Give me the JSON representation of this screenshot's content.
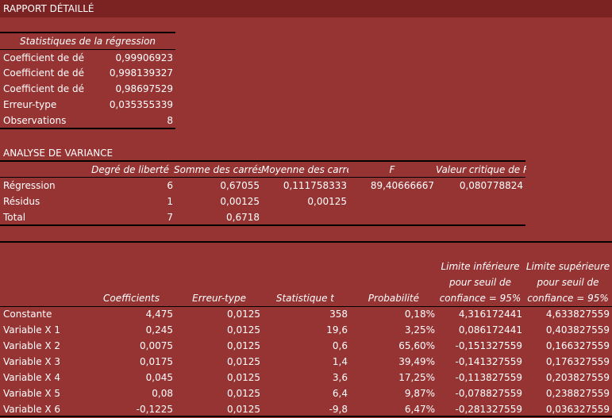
{
  "report_title": "RAPPORT DÉTAILLÉ",
  "regression_stats": {
    "header": "Statistiques de la régression",
    "rows": [
      {
        "label": "Coefficient de dé",
        "value": "0,99906923"
      },
      {
        "label": "Coefficient de dé",
        "value": "0,998139327"
      },
      {
        "label": "Coefficient de dé",
        "value": "0,98697529"
      },
      {
        "label": "Erreur-type",
        "value": "0,035355339"
      },
      {
        "label": "Observations",
        "value": "8"
      }
    ]
  },
  "anova": {
    "title": "ANALYSE DE VARIANCE",
    "headers": [
      "Degré de liberté",
      "Somme des carrés",
      "Moyenne des carré",
      "F",
      "Valeur critique de F"
    ],
    "rows": [
      {
        "label": "Régression",
        "values": [
          "6",
          "0,67055",
          "0,111758333",
          "89,40666667",
          "0,080778824"
        ]
      },
      {
        "label": "Résidus",
        "values": [
          "1",
          "0,00125",
          "0,00125",
          "",
          ""
        ]
      },
      {
        "label": "Total",
        "values": [
          "7",
          "0,6718",
          "",
          "",
          ""
        ]
      }
    ]
  },
  "coefficients": {
    "headers": [
      "Coefficients",
      "Erreur-type",
      "Statistique t",
      "Probabilité",
      [
        "Limite inférieure",
        "pour seuil de",
        "confiance = 95%"
      ],
      [
        "Limite supérieure",
        "pour seuil de",
        "confiance = 95%"
      ]
    ],
    "rows": [
      {
        "label": "Constante",
        "values": [
          "4,475",
          "0,0125",
          "358",
          "0,18%",
          "4,316172441",
          "4,633827559"
        ]
      },
      {
        "label": "Variable X 1",
        "values": [
          "0,245",
          "0,0125",
          "19,6",
          "3,25%",
          "0,086172441",
          "0,403827559"
        ]
      },
      {
        "label": "Variable X 2",
        "values": [
          "0,0075",
          "0,0125",
          "0,6",
          "65,60%",
          "-0,151327559",
          "0,166327559"
        ]
      },
      {
        "label": "Variable X 3",
        "values": [
          "0,0175",
          "0,0125",
          "1,4",
          "39,49%",
          "-0,141327559",
          "0,176327559"
        ]
      },
      {
        "label": "Variable X 4",
        "values": [
          "0,045",
          "0,0125",
          "3,6",
          "17,25%",
          "-0,113827559",
          "0,203827559"
        ]
      },
      {
        "label": "Variable X 5",
        "values": [
          "0,08",
          "0,0125",
          "6,4",
          "9,87%",
          "-0,078827559",
          "0,238827559"
        ]
      },
      {
        "label": "Variable X 6",
        "values": [
          "-0,1225",
          "0,0125",
          "-9,8",
          "6,47%",
          "-0,281327559",
          "0,036327559"
        ]
      }
    ]
  }
}
